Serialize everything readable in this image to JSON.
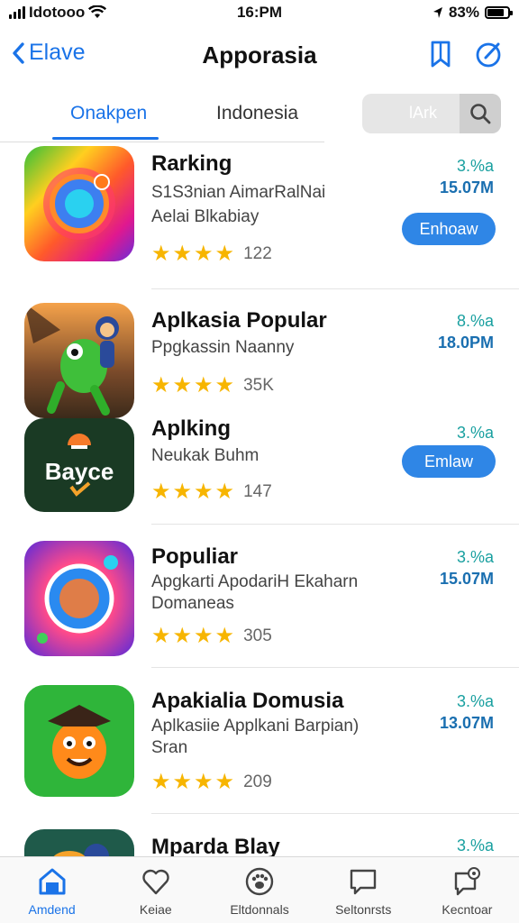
{
  "status_bar": {
    "carrier": "Idotooo",
    "time": "16:PM",
    "battery_pct": "83%",
    "battery_level": 0.83
  },
  "nav": {
    "back_label": "Elave",
    "title": "Apporasia"
  },
  "tabs": {
    "tab1": "Onakpen",
    "tab2": "Indonesia",
    "search_placeholder": "lArk"
  },
  "apps": [
    {
      "name": "Rarking",
      "sub1": "S1S3nian AimarRalNai",
      "sub2": "Aelai Blkabiay",
      "rating_count": "122",
      "pct": "3.%a",
      "size": "15.07M",
      "button": "Enhoaw"
    },
    {
      "name": "Aplkasia Popular",
      "sub1": "Ppgkassin Naanny",
      "sub2": "",
      "rating_count": "35K",
      "pct": "8.%a",
      "size": "18.0PM",
      "button": ""
    },
    {
      "name": "Aplking",
      "sub1": "Neukak Buhm",
      "sub2": "",
      "rating_count": "147",
      "pct": "3.%a",
      "size": "",
      "button": "Emlaw",
      "icon_text": "Bayce"
    },
    {
      "name": "Populiar",
      "sub1": "Apgkarti ApodariH Ekaharn",
      "sub2": "Domaneas",
      "rating_count": "305",
      "pct": "3.%a",
      "size": "15.07M",
      "button": ""
    },
    {
      "name": "Apakialia Domusia",
      "sub1": "Aplkasiie Applkani Barpian)",
      "sub2": "Sran",
      "rating_count": "209",
      "pct": "3.%a",
      "size": "13.07M",
      "button": ""
    },
    {
      "name": "Mparda Blay",
      "pct": "3.%a"
    }
  ],
  "tab_bar": [
    {
      "label": "Amdend",
      "icon": "home-icon"
    },
    {
      "label": "Keiae",
      "icon": "heart-icon"
    },
    {
      "label": "Eltdonnals",
      "icon": "paw-icon"
    },
    {
      "label": "Seltonrsts",
      "icon": "chat-icon"
    },
    {
      "label": "Kecntoar",
      "icon": "chat-alert-icon"
    }
  ],
  "colors": {
    "accent": "#1a73e8",
    "button": "#2f86e6",
    "star": "#f7b500",
    "percent": "#1aa0a0",
    "size": "#1a6fb0"
  }
}
